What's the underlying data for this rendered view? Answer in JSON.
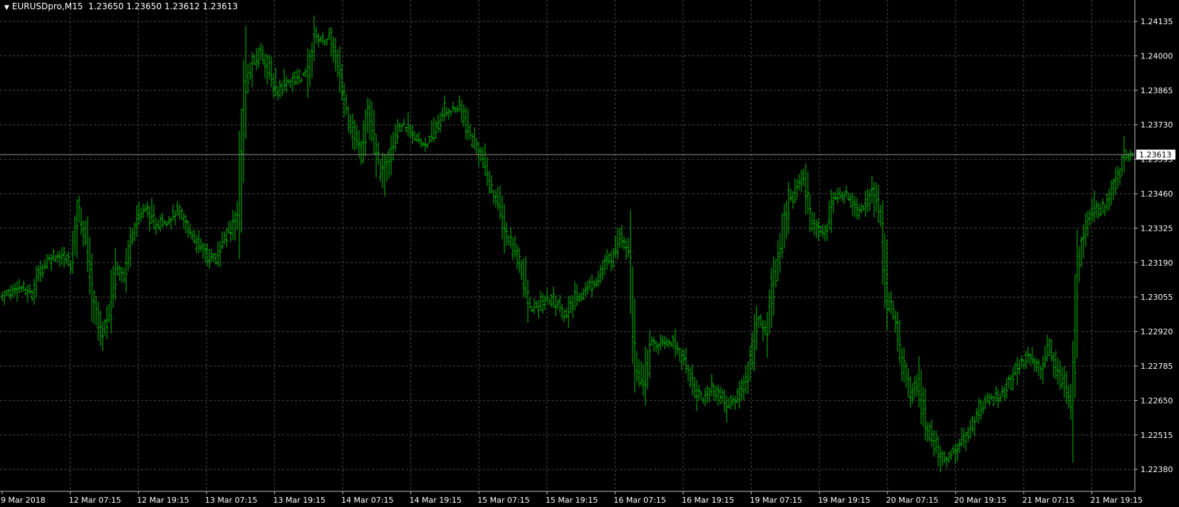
{
  "header": {
    "symbol": "EURUSDpro,M15",
    "ohlc": "1.23650 1.23650 1.23612 1.23613"
  },
  "colors": {
    "background": "#000000",
    "grid": "#4a4a4a",
    "axis": "#c0c0c0",
    "bars": "#00c000",
    "current_line": "#909090",
    "price_tag_bg": "#ffffff",
    "price_tag_text": "#000000"
  },
  "chart_data": {
    "type": "line",
    "grid": true,
    "y_axis_position": "right",
    "ylim": [
      1.2233,
      1.242
    ],
    "y_ticks": [
      "1.24135",
      "1.24000",
      "1.23865",
      "1.23730",
      "1.23595",
      "1.23460",
      "1.23325",
      "1.23190",
      "1.23055",
      "1.22920",
      "1.22785",
      "1.22650",
      "1.22515",
      "1.22380"
    ],
    "x_ticks": [
      "9 Mar 2018",
      "12 Mar 07:15",
      "12 Mar 19:15",
      "13 Mar 07:15",
      "13 Mar 19:15",
      "14 Mar 07:15",
      "14 Mar 19:15",
      "15 Mar 07:15",
      "15 Mar 19:15",
      "16 Mar 07:15",
      "16 Mar 19:15",
      "19 Mar 07:15",
      "19 Mar 19:15",
      "20 Mar 07:15",
      "20 Mar 19:15",
      "21 Mar 07:15",
      "21 Mar 19:15"
    ],
    "current_price": "1.23613",
    "series": [
      {
        "values": [
          1.2306,
          1.2307,
          1.231,
          1.2308,
          1.2307,
          1.2316,
          1.232,
          1.2322,
          1.2321,
          1.2319,
          1.234,
          1.2328,
          1.2305,
          1.229,
          1.2298,
          1.2318,
          1.2314,
          1.233,
          1.2338,
          1.234,
          1.2334,
          1.2336,
          1.2336,
          1.2339,
          1.2334,
          1.233,
          1.2325,
          1.2322,
          1.232,
          1.2328,
          1.2332,
          1.234,
          1.239,
          1.2397,
          1.2402,
          1.2394,
          1.2386,
          1.239,
          1.239,
          1.2392,
          1.2392,
          1.2408,
          1.2406,
          1.2407,
          1.2396,
          1.2381,
          1.237,
          1.2363,
          1.2378,
          1.2362,
          1.2352,
          1.2365,
          1.2373,
          1.2372,
          1.2368,
          1.2366,
          1.2366,
          1.2373,
          1.2378,
          1.2379,
          1.238,
          1.2371,
          1.2365,
          1.236,
          1.2348,
          1.2343,
          1.233,
          1.2325,
          1.2318,
          1.2302,
          1.2301,
          1.2304,
          1.2305,
          1.2302,
          1.2298,
          1.2305,
          1.2307,
          1.231,
          1.2313,
          1.2318,
          1.2322,
          1.233,
          1.2325,
          1.228,
          1.227,
          1.2288,
          1.2286,
          1.2288,
          1.2288,
          1.2282,
          1.2276,
          1.2268,
          1.2266,
          1.227,
          1.2267,
          1.2263,
          1.2265,
          1.227,
          1.228,
          1.2296,
          1.2292,
          1.2312,
          1.2325,
          1.2343,
          1.2348,
          1.2352,
          1.2336,
          1.2331,
          1.2333,
          1.2344,
          1.2346,
          1.2345,
          1.234,
          1.2342,
          1.2348,
          1.2337,
          1.2305,
          1.2295,
          1.2278,
          1.2268,
          1.2272,
          1.2255,
          1.2248,
          1.2242,
          1.2243,
          1.2246,
          1.225,
          1.2255,
          1.2262,
          1.2265,
          1.2266,
          1.2268,
          1.2272,
          1.2278,
          1.2282,
          1.228,
          1.2277,
          1.2286,
          1.2278,
          1.2272,
          1.2262,
          1.232,
          1.2335,
          1.2342,
          1.234,
          1.2344,
          1.2352,
          1.236,
          1.2362
        ]
      }
    ]
  }
}
